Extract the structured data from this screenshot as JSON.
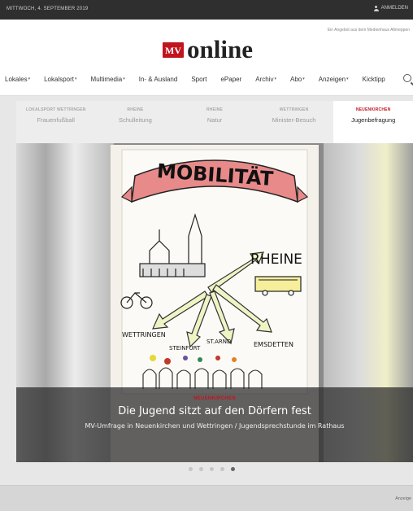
{
  "topbar": {
    "date": "MITTWOCH, 4. SEPTEMBER 2019",
    "login": "ANMELDEN"
  },
  "header": {
    "tagline": "Ein Angebot aus dem Medienhaus Altmeppen",
    "logo_badge": "MV",
    "logo_word": "online",
    "brand_color": "#c0141e"
  },
  "nav": {
    "items": [
      {
        "label": "Lokales",
        "dropdown": true
      },
      {
        "label": "Lokalsport",
        "dropdown": true
      },
      {
        "label": "Multimedia",
        "dropdown": true
      },
      {
        "label": "In- & Ausland",
        "dropdown": false
      },
      {
        "label": "Sport",
        "dropdown": false
      },
      {
        "label": "ePaper",
        "dropdown": false
      },
      {
        "label": "Archiv",
        "dropdown": true
      },
      {
        "label": "Abo",
        "dropdown": true
      },
      {
        "label": "Anzeigen",
        "dropdown": true
      },
      {
        "label": "Kicktipp",
        "dropdown": false
      }
    ],
    "search_icon": "search-icon"
  },
  "tabs": [
    {
      "kicker": "LOKALSPORT WETTRINGEN",
      "title": "Frauenfußball",
      "active": false
    },
    {
      "kicker": "RHEINE",
      "title": "Schulleitung",
      "active": false
    },
    {
      "kicker": "RHEINE",
      "title": "Natur",
      "active": false
    },
    {
      "kicker": "WETTRINGEN",
      "title": "Minister-Besuch",
      "active": false
    },
    {
      "kicker": "NEUENKIRCHEN",
      "title": "Jugenbefragung",
      "active": true
    }
  ],
  "slide": {
    "kicker": "NEUENKIRCHEN",
    "title": "Die Jugend sitzt auf den Dörfern fest",
    "subtitle": "MV-Umfrage in Neuenkirchen und Wettringen / Jugendsprechstunde im Rathaus",
    "poster": {
      "banner": "MOBILITÄT",
      "city": "RHEINE",
      "label_left": "WETTRINGEN",
      "label_steinfurt": "STEINFURT",
      "label_stgrund": "ST.ARND",
      "label_emsdetten": "EMSDETTEN"
    }
  },
  "pager": {
    "count": 5,
    "active_index": 4
  },
  "footer": {
    "ad_label": "Anzeige"
  }
}
